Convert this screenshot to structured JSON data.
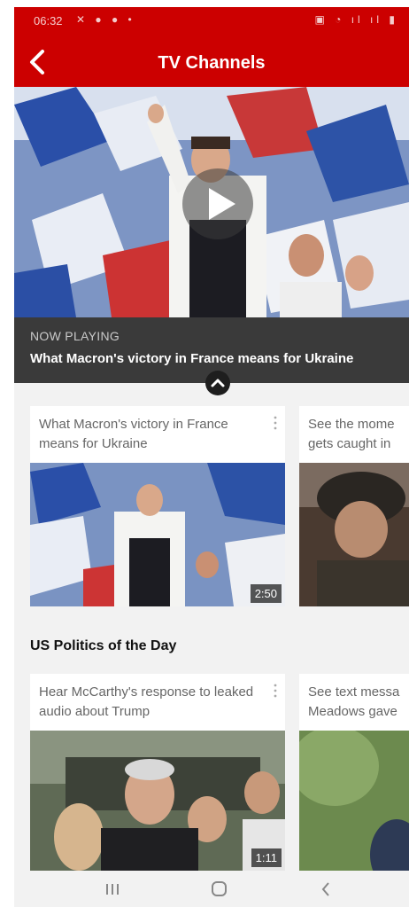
{
  "status_bar": {
    "time": "06:32",
    "left_icons": "✕ ● ● •",
    "right_icons": "▣ ◔ ıl ıl ▮"
  },
  "header": {
    "title": "TV Channels",
    "back_icon": "chevron-left-icon",
    "background": "#cc0000"
  },
  "now_playing": {
    "label": "NOW PLAYING",
    "title": "What Macron's victory in France means for Ukraine"
  },
  "row1": [
    {
      "title": "What Macron's victory in France means for Ukraine",
      "duration": "2:50"
    },
    {
      "title": "See the mome gets caught in"
    }
  ],
  "section": {
    "title": "US Politics of the Day"
  },
  "row2": [
    {
      "title": "Hear McCarthy's response to leaked audio about Trump",
      "duration": "1:11"
    },
    {
      "title": "See text messa Meadows gave"
    }
  ],
  "nav": {
    "recents_icon": "recents-icon",
    "home_icon": "home-icon",
    "back_icon": "back-icon"
  }
}
